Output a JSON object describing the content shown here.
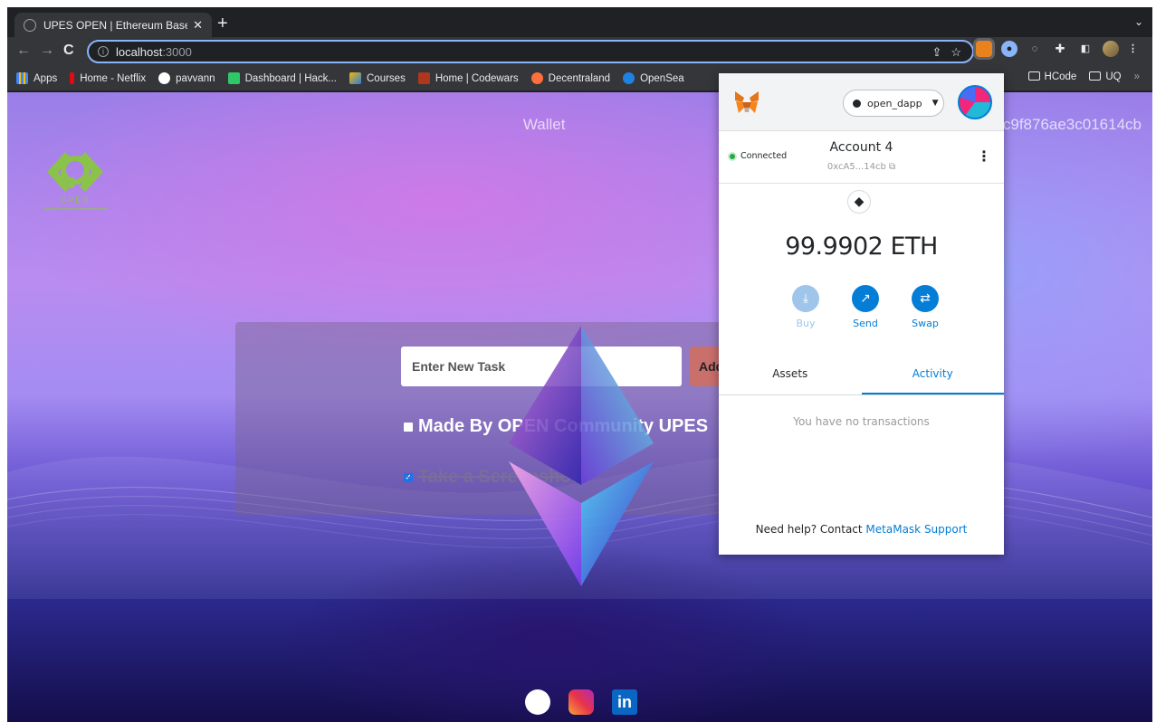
{
  "browser": {
    "tab_title": "UPES OPEN | Ethereum Based",
    "tab_close": "✕",
    "new_tab": "+",
    "tab_menu": "⌄",
    "url_host": "localhost",
    "url_port": ":3000"
  },
  "bookmarks": [
    {
      "label": "Apps",
      "color": "#e8eaed"
    },
    {
      "label": "Home - Netflix",
      "color": "#e50914"
    },
    {
      "label": "pavvann",
      "color": "#ffffff"
    },
    {
      "label": "Dashboard | Hack...",
      "color": "#2ec866"
    },
    {
      "label": "Courses",
      "color": "#f5b700"
    },
    {
      "label": "Home | Codewars",
      "color": "#b1361e"
    },
    {
      "label": "Decentraland",
      "color": "#ff2d55"
    },
    {
      "label": "OpenSea",
      "color": "#2081e2"
    }
  ],
  "bookmarks_right": [
    "HCode",
    "UQ"
  ],
  "bookmarks_overflow": "»",
  "page": {
    "wallet_prefix": "Wallet",
    "wallet_suffix": "c9f876ae3c01614cb",
    "logo_text": "OPEN",
    "task_placeholder": "Enter New Task",
    "add_button": "Add",
    "tasks": [
      {
        "text": "Made By OPEN Community UPES",
        "done": false
      },
      {
        "text": "Take a Screenshot",
        "done": true
      }
    ]
  },
  "metamask": {
    "network": "open_dapp",
    "connected": "Connected",
    "account_name": "Account 4",
    "account_address": "0xcA5...14cb",
    "balance": "99.9902 ETH",
    "actions": [
      "Buy",
      "Send",
      "Swap"
    ],
    "tabs": [
      "Assets",
      "Activity"
    ],
    "empty_activity": "You have no transactions",
    "help_prefix": "Need help? Contact",
    "help_link": "MetaMask Support"
  }
}
